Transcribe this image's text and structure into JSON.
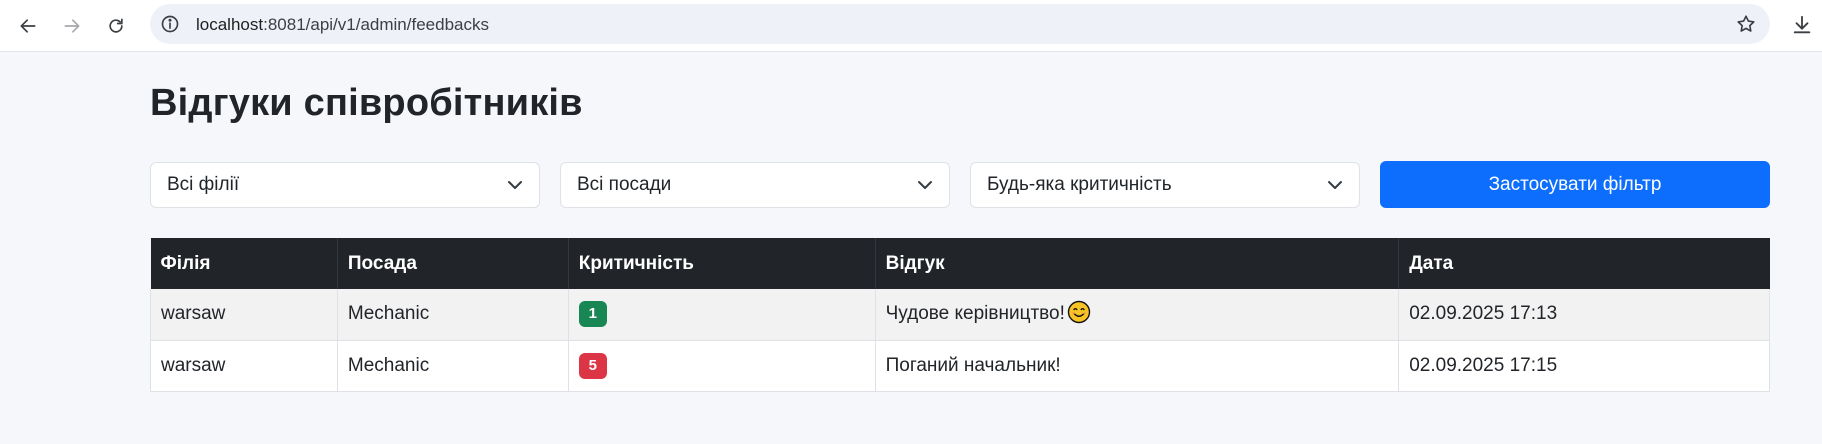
{
  "browser": {
    "url_host": "localhost",
    "url_rest": ":8081/api/v1/admin/feedbacks",
    "icons": {
      "back": "back-arrow-icon",
      "forward": "forward-arrow-icon",
      "reload": "reload-icon",
      "site_info": "info-icon",
      "bookmark": "star-icon",
      "download": "download-icon"
    }
  },
  "page": {
    "title": "Відгуки співробітників"
  },
  "filters": {
    "branch": "Всі філії",
    "position": "Всі посади",
    "criticality": "Будь-яка критичність",
    "apply_label": "Застосувати фільтр"
  },
  "table": {
    "headers": {
      "branch": "Філія",
      "position": "Посада",
      "criticality": "Критичність",
      "feedback": "Відгук",
      "date": "Дата"
    },
    "rows": [
      {
        "branch": "warsaw",
        "position": "Mechanic",
        "criticality": "1",
        "criticality_color": "#198754",
        "feedback": "Чудове керівництво!",
        "emoji": "smiling-face-icon",
        "date": "02.09.2025 17:13"
      },
      {
        "branch": "warsaw",
        "position": "Mechanic",
        "criticality": "5",
        "criticality_color": "#dc3545",
        "feedback": "Поганий начальник!",
        "date": "02.09.2025 17:15"
      }
    ]
  },
  "colors": {
    "primary": "#0d6efd",
    "table_header": "#212529",
    "low_criticality": "#198754",
    "high_criticality": "#dc3545"
  }
}
